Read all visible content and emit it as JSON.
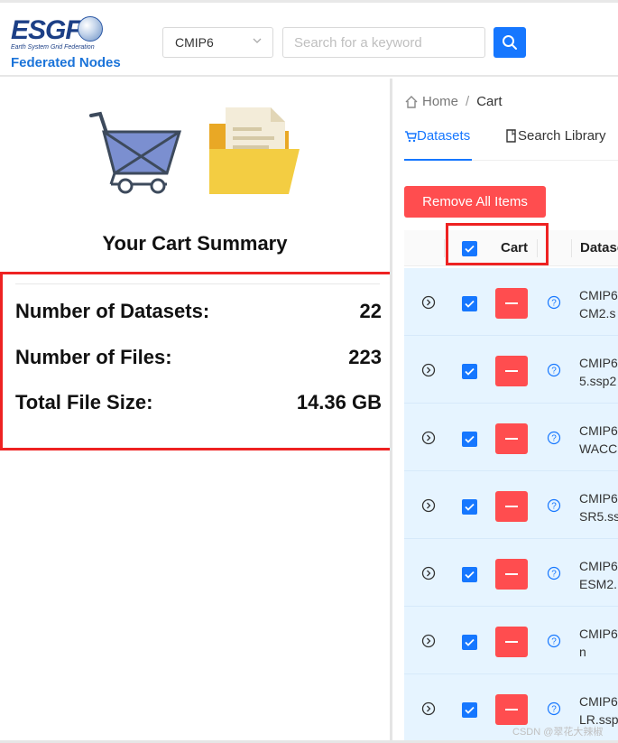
{
  "header": {
    "logo_text": "ESGF",
    "logo_subtitle": "Earth System Grid Federation",
    "logo_nodes": "Federated Nodes",
    "project_select": "CMIP6",
    "search_placeholder": "Search for a keyword"
  },
  "left": {
    "summary_title": "Your Cart Summary",
    "stats": [
      {
        "label": "Number of Datasets:",
        "value": "22"
      },
      {
        "label": "Number of Files:",
        "value": "223"
      },
      {
        "label": "Total File Size:",
        "value": "14.36 GB"
      }
    ]
  },
  "right": {
    "breadcrumb": {
      "home": "Home",
      "separator": "/",
      "current": "Cart"
    },
    "tabs": [
      {
        "label": "Datasets"
      },
      {
        "label": "Search Library"
      }
    ],
    "remove_all_label": "Remove All Items",
    "table": {
      "header_cart": "Cart",
      "header_dataset": "Datase",
      "rows": [
        {
          "line1": "CMIP6",
          "line2": "CM2.s"
        },
        {
          "line1": "CMIP6",
          "line2": "5.ssp2"
        },
        {
          "line1": "CMIP6",
          "line2": "WACC"
        },
        {
          "line1": "CMIP6",
          "line2": "SR5.ss"
        },
        {
          "line1": "CMIP6",
          "line2": "ESM2."
        },
        {
          "line1": "CMIP6",
          "line2": "n"
        },
        {
          "line1": "CMIP6",
          "line2": "LR.ssp"
        }
      ]
    }
  },
  "watermark": "CSDN @翠花大辣椒",
  "colors": {
    "accent": "#1677ff",
    "danger": "#ff4d4f",
    "highlight_box": "#ee2222",
    "row_bg": "#e6f4ff"
  }
}
